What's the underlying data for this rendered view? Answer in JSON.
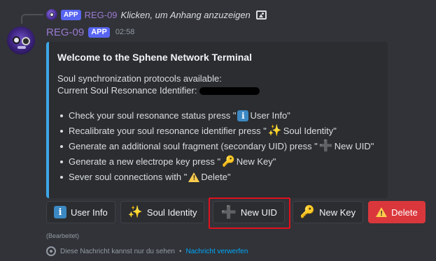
{
  "reply": {
    "app_badge": "APP",
    "author": "REG-09",
    "text": "Klicken, um Anhang anzuzeigen",
    "attachment_icon": "image-icon"
  },
  "message": {
    "author": "REG-09",
    "app_badge": "APP",
    "time": "02:58",
    "edited": "(Bearbeitet)"
  },
  "embed": {
    "accent": "#3ea6e8",
    "title": "Welcome to the Sphene Network Terminal",
    "desc_line1": "Soul synchronization protocols available:",
    "desc_line2": "Current Soul Resonance Identifier:",
    "items": [
      {
        "pre": "Check your soul resonance status press \"",
        "emoji": "info-icon",
        "label": "User Info",
        "post": "\""
      },
      {
        "pre": "Recalibrate your soul resonance identifier press \"",
        "emoji": "sparkles-icon",
        "label": "Soul Identity",
        "post": "\""
      },
      {
        "pre": "Generate an additional soul fragment (secondary UID) press \"",
        "emoji": "plus-icon",
        "label": "New UID",
        "post": "\""
      },
      {
        "pre": "Generate a new electrope key press \"",
        "emoji": "key-icon",
        "label": "New Key",
        "post": "\""
      },
      {
        "pre": "Sever soul connections with \"",
        "emoji": "warning-icon",
        "label": "Delete",
        "post": "\""
      }
    ]
  },
  "buttons": [
    {
      "label": "User Info",
      "icon": "info-icon",
      "style": "secondary"
    },
    {
      "label": "Soul Identity",
      "icon": "sparkles-icon",
      "style": "secondary"
    },
    {
      "label": "New UID",
      "icon": "plus-icon",
      "style": "secondary"
    },
    {
      "label": "New Key",
      "icon": "key-icon",
      "style": "secondary"
    },
    {
      "label": "Delete",
      "icon": "warning-icon",
      "style": "danger"
    }
  ],
  "ephemeral": {
    "text": "Diese Nachricht kannst nur du sehen",
    "separator": "•",
    "link": "Nachricht verwerfen"
  },
  "colors": {
    "background": "#313338",
    "embed_bg": "#2b2d31",
    "danger": "#da373c",
    "app_badge": "#5865f2",
    "author": "#9b7ad0",
    "highlight": "#e0101e"
  }
}
